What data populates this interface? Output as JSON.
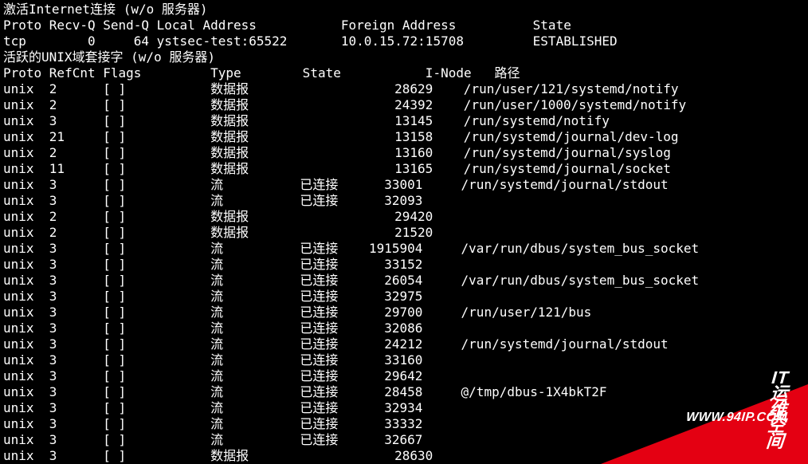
{
  "inet": {
    "title": "激活Internet连接 (w/o 服务器)",
    "hdr": {
      "proto": "Proto",
      "recvq": "Recv-Q",
      "sendq": "Send-Q",
      "local": "Local Address",
      "foreign": "Foreign Address",
      "state": "State"
    },
    "rows": [
      {
        "proto": "tcp",
        "recvq": "0",
        "sendq": "64",
        "local": "ystsec-test:65522",
        "foreign": "10.0.15.72:15708",
        "state": "ESTABLISHED"
      }
    ]
  },
  "unix": {
    "title": "活跃的UNIX域套接字 (w/o 服务器)",
    "hdr": {
      "proto": "Proto",
      "refcnt": "RefCnt",
      "flags": "Flags",
      "type": "Type",
      "state": "State",
      "inode": "I-Node",
      "path": "路径"
    },
    "rows": [
      {
        "proto": "unix",
        "refcnt": "2",
        "flags": "[ ]",
        "type": "数据报",
        "state": "",
        "inode": "28629",
        "path": "/run/user/121/systemd/notify"
      },
      {
        "proto": "unix",
        "refcnt": "2",
        "flags": "[ ]",
        "type": "数据报",
        "state": "",
        "inode": "24392",
        "path": "/run/user/1000/systemd/notify"
      },
      {
        "proto": "unix",
        "refcnt": "3",
        "flags": "[ ]",
        "type": "数据报",
        "state": "",
        "inode": "13145",
        "path": "/run/systemd/notify"
      },
      {
        "proto": "unix",
        "refcnt": "21",
        "flags": "[ ]",
        "type": "数据报",
        "state": "",
        "inode": "13158",
        "path": "/run/systemd/journal/dev-log"
      },
      {
        "proto": "unix",
        "refcnt": "2",
        "flags": "[ ]",
        "type": "数据报",
        "state": "",
        "inode": "13160",
        "path": "/run/systemd/journal/syslog"
      },
      {
        "proto": "unix",
        "refcnt": "11",
        "flags": "[ ]",
        "type": "数据报",
        "state": "",
        "inode": "13165",
        "path": "/run/systemd/journal/socket"
      },
      {
        "proto": "unix",
        "refcnt": "3",
        "flags": "[ ]",
        "type": "流",
        "state": "已连接",
        "inode": "33001",
        "path": "/run/systemd/journal/stdout"
      },
      {
        "proto": "unix",
        "refcnt": "3",
        "flags": "[ ]",
        "type": "流",
        "state": "已连接",
        "inode": "32093",
        "path": ""
      },
      {
        "proto": "unix",
        "refcnt": "2",
        "flags": "[ ]",
        "type": "数据报",
        "state": "",
        "inode": "29420",
        "path": ""
      },
      {
        "proto": "unix",
        "refcnt": "2",
        "flags": "[ ]",
        "type": "数据报",
        "state": "",
        "inode": "21520",
        "path": ""
      },
      {
        "proto": "unix",
        "refcnt": "3",
        "flags": "[ ]",
        "type": "流",
        "state": "已连接",
        "inode": "1915904",
        "path": "/var/run/dbus/system_bus_socket"
      },
      {
        "proto": "unix",
        "refcnt": "3",
        "flags": "[ ]",
        "type": "流",
        "state": "已连接",
        "inode": "33152",
        "path": ""
      },
      {
        "proto": "unix",
        "refcnt": "3",
        "flags": "[ ]",
        "type": "流",
        "state": "已连接",
        "inode": "26054",
        "path": "/var/run/dbus/system_bus_socket"
      },
      {
        "proto": "unix",
        "refcnt": "3",
        "flags": "[ ]",
        "type": "流",
        "state": "已连接",
        "inode": "32975",
        "path": ""
      },
      {
        "proto": "unix",
        "refcnt": "3",
        "flags": "[ ]",
        "type": "流",
        "state": "已连接",
        "inode": "29700",
        "path": "/run/user/121/bus"
      },
      {
        "proto": "unix",
        "refcnt": "3",
        "flags": "[ ]",
        "type": "流",
        "state": "已连接",
        "inode": "32086",
        "path": ""
      },
      {
        "proto": "unix",
        "refcnt": "3",
        "flags": "[ ]",
        "type": "流",
        "state": "已连接",
        "inode": "24212",
        "path": "/run/systemd/journal/stdout"
      },
      {
        "proto": "unix",
        "refcnt": "3",
        "flags": "[ ]",
        "type": "流",
        "state": "已连接",
        "inode": "33160",
        "path": ""
      },
      {
        "proto": "unix",
        "refcnt": "3",
        "flags": "[ ]",
        "type": "流",
        "state": "已连接",
        "inode": "29642",
        "path": ""
      },
      {
        "proto": "unix",
        "refcnt": "3",
        "flags": "[ ]",
        "type": "流",
        "state": "已连接",
        "inode": "28458",
        "path": "@/tmp/dbus-1X4bkT2F"
      },
      {
        "proto": "unix",
        "refcnt": "3",
        "flags": "[ ]",
        "type": "流",
        "state": "已连接",
        "inode": "32934",
        "path": ""
      },
      {
        "proto": "unix",
        "refcnt": "3",
        "flags": "[ ]",
        "type": "流",
        "state": "已连接",
        "inode": "33332",
        "path": ""
      },
      {
        "proto": "unix",
        "refcnt": "3",
        "flags": "[ ]",
        "type": "流",
        "state": "已连接",
        "inode": "32667",
        "path": ""
      },
      {
        "proto": "unix",
        "refcnt": "3",
        "flags": "[ ]",
        "type": "数据报",
        "state": "",
        "inode": "28630",
        "path": ""
      }
    ]
  },
  "watermark": {
    "url": "WWW.94IP.COM",
    "txt": "IT运维空间"
  }
}
